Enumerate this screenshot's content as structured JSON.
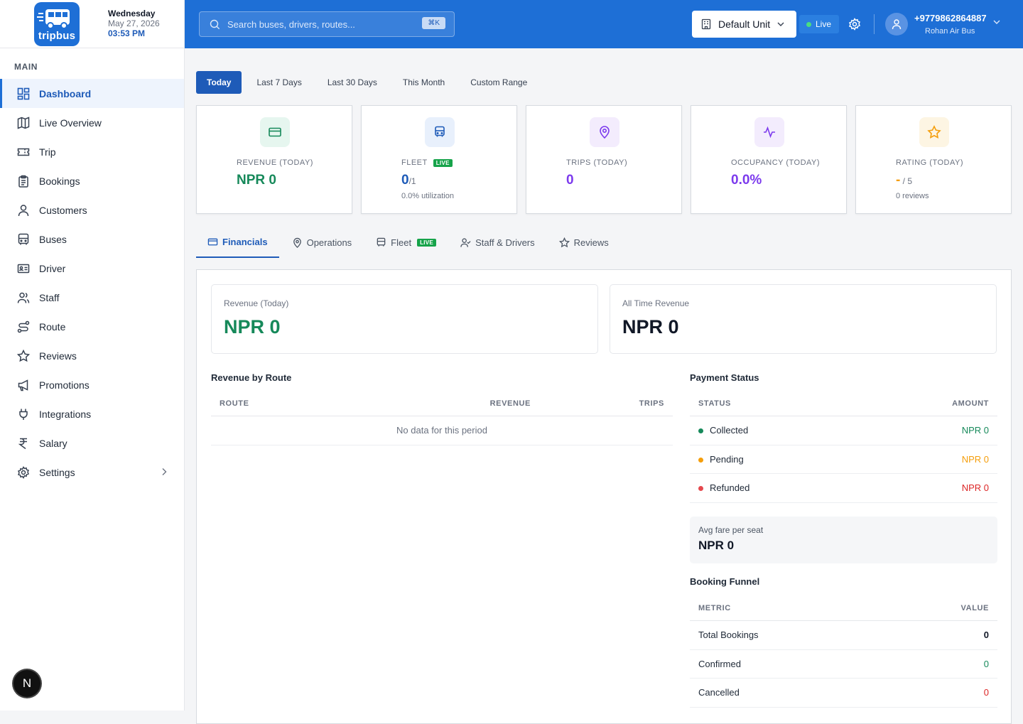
{
  "brand": {
    "logo_text": "tripbus",
    "day": "Wednesday",
    "date": "May 27, 2026",
    "time": "03:53 PM"
  },
  "sidebar": {
    "section": "MAIN",
    "items": [
      {
        "label": "Dashboard",
        "icon": "dashboard-icon"
      },
      {
        "label": "Live Overview",
        "icon": "map-icon"
      },
      {
        "label": "Trip",
        "icon": "ticket-icon"
      },
      {
        "label": "Bookings",
        "icon": "clipboard-icon"
      },
      {
        "label": "Customers",
        "icon": "user-icon"
      },
      {
        "label": "Buses",
        "icon": "bus-icon"
      },
      {
        "label": "Driver",
        "icon": "id-card-icon"
      },
      {
        "label": "Staff",
        "icon": "users-icon"
      },
      {
        "label": "Route",
        "icon": "route-icon"
      },
      {
        "label": "Reviews",
        "icon": "star-icon"
      },
      {
        "label": "Promotions",
        "icon": "megaphone-icon"
      },
      {
        "label": "Integrations",
        "icon": "plug-icon"
      },
      {
        "label": "Salary",
        "icon": "rupee-icon"
      },
      {
        "label": "Settings",
        "icon": "gear-icon"
      }
    ],
    "n_button": "N"
  },
  "topbar": {
    "search_placeholder": "Search buses, drivers, routes...",
    "shortcut": "⌘K",
    "unit": "Default Unit",
    "live": "Live",
    "phone": "+9779862864887",
    "user": "Rohan Air Bus"
  },
  "ranges": [
    "Today",
    "Last 7 Days",
    "Last 30 Days",
    "This Month",
    "Custom Range"
  ],
  "cards": {
    "revenue": {
      "label": "REVENUE (TODAY)",
      "value": "NPR 0",
      "color": "#16895a"
    },
    "fleet": {
      "label": "FLEET",
      "badge": "LIVE",
      "value": "0",
      "value_suffix": "/1",
      "sub": "0.0% utilization",
      "color": "#1e5bb8"
    },
    "trips": {
      "label": "TRIPS (TODAY)",
      "value": "0",
      "color": "#7c3aed"
    },
    "occupancy": {
      "label": "OCCUPANCY (TODAY)",
      "value": "0.0%",
      "color": "#7c3aed"
    },
    "rating": {
      "label": "RATING (TODAY)",
      "value": "-",
      "value_suffix": " / 5",
      "sub": "0 reviews",
      "color": "#f59e0b"
    }
  },
  "tabs": {
    "financials": "Financials",
    "operations": "Operations",
    "fleet": "Fleet",
    "fleet_badge": "LIVE",
    "staff": "Staff & Drivers",
    "reviews": "Reviews"
  },
  "financials": {
    "rev_today_label": "Revenue (Today)",
    "rev_today_value": "NPR 0",
    "all_time_label": "All Time Revenue",
    "all_time_value": "NPR 0",
    "by_route": {
      "title": "Revenue by Route",
      "headers": [
        "ROUTE",
        "REVENUE",
        "TRIPS"
      ],
      "empty": "No data for this period"
    },
    "payment": {
      "title": "Payment Status",
      "headers": [
        "STATUS",
        "AMOUNT"
      ],
      "rows": [
        {
          "status": "Collected",
          "amount": "NPR 0",
          "color": "#16895a"
        },
        {
          "status": "Pending",
          "amount": "NPR 0",
          "color": "#f59e0b"
        },
        {
          "status": "Refunded",
          "amount": "NPR 0",
          "color": "#dc2626"
        }
      ]
    },
    "avg_fare_label": "Avg fare per seat",
    "avg_fare_value": "NPR 0",
    "funnel": {
      "title": "Booking Funnel",
      "headers": [
        "METRIC",
        "VALUE"
      ],
      "rows": [
        {
          "metric": "Total Bookings",
          "value": "0",
          "color": "#111827"
        },
        {
          "metric": "Confirmed",
          "value": "0",
          "color": "#16895a"
        },
        {
          "metric": "Cancelled",
          "value": "0",
          "color": "#dc2626"
        }
      ]
    }
  }
}
